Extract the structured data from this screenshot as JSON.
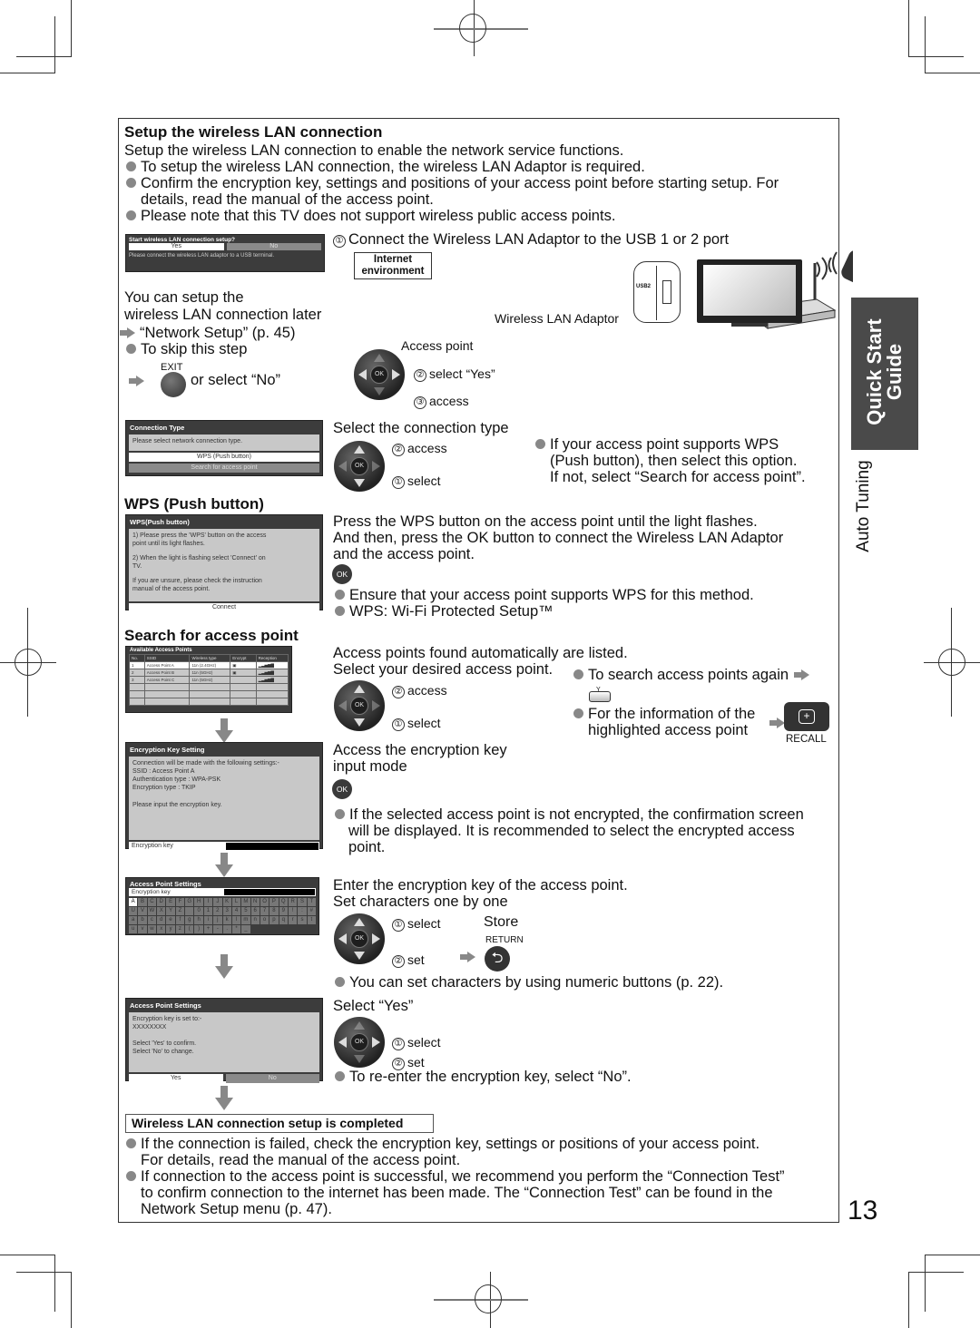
{
  "page_number": "13",
  "side_tab": {
    "title_line1": "Quick Start",
    "title_line2": "Guide",
    "section": "Auto Tuning"
  },
  "header": {
    "title": "Setup the wireless LAN connection",
    "intro": "Setup the wireless LAN connection to enable the network service functions.",
    "bullets": [
      "To setup the wireless LAN connection, the wireless LAN Adaptor is required.",
      "Confirm the encryption key, settings and positions of your access point before starting setup. For",
      "details, read the manual of the access point.",
      "Please note that this TV does not support wireless public access points."
    ]
  },
  "step1": {
    "osd": {
      "title": "Start wireless LAN connection setup?",
      "yes": "Yes",
      "no": "No",
      "message": "Please connect the wireless LAN adaptor to a USB terminal."
    },
    "later_line1": "You can setup the",
    "later_line2": "wireless LAN connection later",
    "later_link": "“Network Setup” (p. 45)",
    "skip": "To skip this step",
    "exit_label": "EXIT",
    "or_select_no": "or select “No”",
    "connect_instruction": "Connect the Wireless LAN Adaptor to the USB 1 or 2 port",
    "num1": "①",
    "internet_label_1": "Internet",
    "internet_label_2": "environment",
    "adaptor_label": "Wireless LAN Adaptor",
    "access_point_label": "Access point",
    "usb_label": "USB2",
    "num2": "②",
    "select_yes": "select “Yes”",
    "num3": "③",
    "access": "access",
    "ok": "OK"
  },
  "step2": {
    "osd": {
      "title": "Connection Type",
      "message": "Please select network connection type.",
      "option1": "WPS (Push button)",
      "option2": "Search for access point"
    },
    "heading": "Select the connection type",
    "access": "access",
    "select": "select",
    "note_line1": "If your access point supports WPS",
    "note_line2": "(Push button), then select this option.",
    "note_line3": "If not, select “Search for access point”."
  },
  "wps": {
    "heading": "WPS (Push button)",
    "osd": {
      "title": "WPS(Push button)",
      "line1": "1) Please press the 'WPS' button on the access",
      "line2": "point until its light flashes.",
      "line3": "2) When the light is flashing select 'Connect' on",
      "line4": "TV.",
      "line5": "If you are unsure, please check the instruction",
      "line6": "manual of the access point.",
      "button": "Connect"
    },
    "text1": "Press the WPS button on the access point until the light flashes.",
    "text2": "And then, press the OK button to connect the Wireless LAN Adaptor",
    "text3": "and the access point.",
    "bullet1": "Ensure that your access point supports WPS for this method.",
    "bullet2": "WPS: Wi-Fi Protected Setup™"
  },
  "search": {
    "heading": "Search for access point",
    "osd": {
      "title": "Available Access Points",
      "columns": [
        "No.",
        "SSID",
        "Wireless type",
        "Encrypt",
        "Reception"
      ],
      "rows": [
        [
          "1",
          "Access Point A",
          "11n (2.4GHz)",
          "▣",
          "▂▃▅▆▇"
        ],
        [
          "2",
          "Access Point B",
          "11n (5GHz)",
          "▣",
          "▂▃▅▆▇"
        ],
        [
          "3",
          "Access Point C",
          "11n (5GHz)",
          "",
          "▂▃▅▆▇"
        ]
      ]
    },
    "text1": "Access points found automatically are listed.",
    "text2": "Select your desired access point.",
    "access": "access",
    "select": "select",
    "again": "To search access points again",
    "y_label": "Y",
    "info_line1": "For the information of the",
    "info_line2": "highlighted access point",
    "recall": "RECALL"
  },
  "enc": {
    "osd": {
      "title": "Encryption Key Setting",
      "line1": "Connection will be made with the following settings:-",
      "line2": "SSID : Access Point A",
      "line3": "Authentication type : WPA-PSK",
      "line4": "Encryption type : TKIP",
      "line5": "Please input the encryption key.",
      "field": "Encryption key"
    },
    "text1": "Access the encryption key",
    "text2": "input mode",
    "bullet_line1": "If the selected access point is not encrypted, the confirmation screen",
    "bullet_line2": "will be displayed. It is recommended to select the encrypted access",
    "bullet_line3": "point."
  },
  "keyboard": {
    "osd": {
      "title": "Access Point Settings",
      "field": "Encryption key",
      "keys": [
        "A",
        "B",
        "C",
        "D",
        "E",
        "F",
        "G",
        "H",
        "I",
        "J",
        "K",
        "L",
        "M",
        "N",
        "O",
        "P",
        "Q",
        "R",
        "S",
        "T",
        "U",
        "V",
        "W",
        "X",
        "Y",
        "Z",
        " ",
        "0",
        "1",
        "2",
        "3",
        "4",
        "5",
        "6",
        "7",
        "8",
        "9",
        "!",
        ":",
        "#",
        "a",
        "b",
        "c",
        "d",
        "e",
        "f",
        "g",
        "h",
        "i",
        "j",
        "k",
        "l",
        "m",
        "n",
        "o",
        "p",
        "q",
        "r",
        "s",
        "t",
        "u",
        "v",
        "w",
        "x",
        "y",
        "z",
        "(",
        ")",
        "+",
        "-",
        ".",
        "*",
        "_"
      ]
    },
    "text1": "Enter the encryption key of the access point.",
    "text2": "Set characters one by one",
    "select": "select",
    "set": "set",
    "store": "Store",
    "return_label": "RETURN",
    "bullet": "You can set characters by using numeric buttons (p. 22)."
  },
  "confirm": {
    "osd": {
      "title": "Access Point Settings",
      "line1": "Encryption key is set to:-",
      "line2": "XXXXXXXX",
      "line3": "Select 'Yes' to confirm.",
      "line4": "Select 'No' to change.",
      "yes": "Yes",
      "no": "No"
    },
    "text": "Select “Yes”",
    "select": "select",
    "set": "set",
    "bullet": "To re-enter the encryption key, select “No”."
  },
  "completed": {
    "label": "Wireless LAN connection setup is completed",
    "b1_line1": "If the connection is failed, check the encryption key, settings or positions of your access point.",
    "b1_line2": "For details, read the manual of the access point.",
    "b2_line1": "If connection to the access point is successful, we recommend you perform the “Connection Test”",
    "b2_line2": "to confirm connection to the internet has been made. The “Connection Test” can be found in the",
    "b2_line3": "Network Setup menu (p. 47)."
  }
}
